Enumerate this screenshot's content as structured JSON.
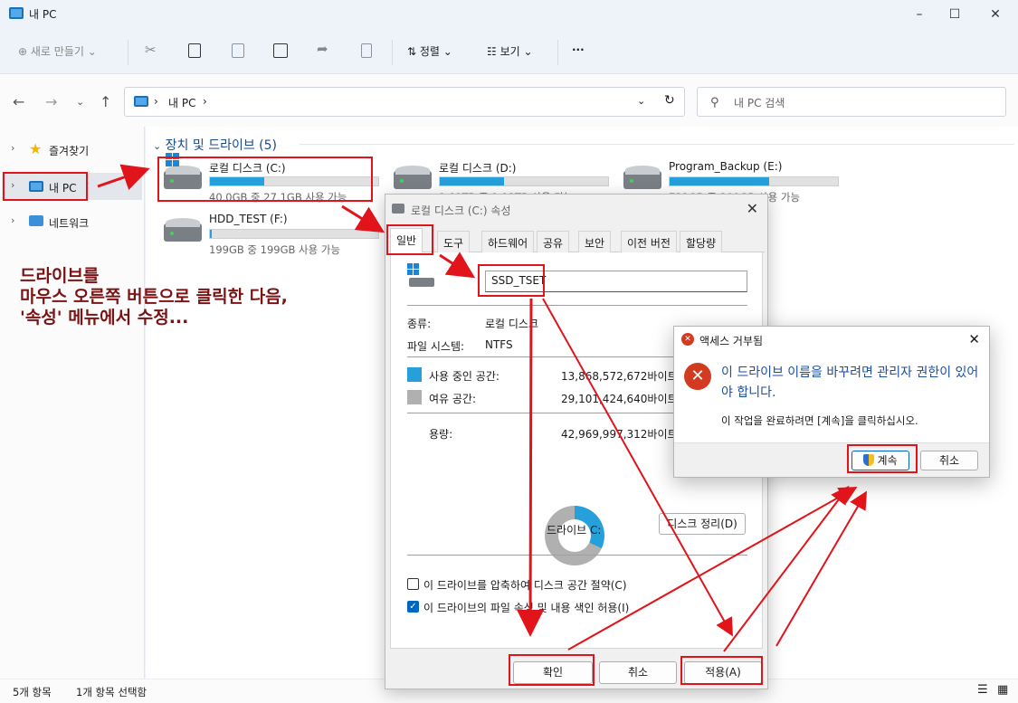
{
  "window": {
    "title": "내 PC"
  },
  "toolbar": {
    "new_label": "새로 만들기",
    "sort_label": "정렬",
    "view_label": "보기",
    "more_label": "···"
  },
  "nav": {
    "breadcrumb_root": "내 PC",
    "search_placeholder": "내 PC 검색"
  },
  "sidebar": {
    "items": [
      {
        "label": "즐겨찾기"
      },
      {
        "label": "내 PC"
      },
      {
        "label": "네트워크"
      }
    ]
  },
  "main": {
    "group_title": "장치 및 드라이브 (5)",
    "drives": [
      {
        "name": "로컬 디스크 (C:)",
        "free_text": "40.0GB 중 27.1GB 사용 가능",
        "used_fraction": 0.32
      },
      {
        "name": "로컬 디스크 (D:)",
        "free_text": "1.81TB 중 1.12TB 사용 가능",
        "used_fraction": 0.38
      },
      {
        "name": "Program_Backup (E:)",
        "free_text": "732GB 중 299GB 사용 가능",
        "used_fraction": 0.59
      },
      {
        "name": "HDD_TEST (F:)",
        "free_text": "199GB 중 199GB 사용 가능",
        "used_fraction": 0.01
      }
    ]
  },
  "status": {
    "item_count": "5개 항목",
    "selected": "1개 항목 선택함"
  },
  "annotation": {
    "text": "드라이브를\n마우스 오른쪽 버튼으로 클릭한 다음,\n'속성' 메뉴에서 수정..."
  },
  "properties": {
    "title": "로컬 디스크 (C:) 속성",
    "tabs": [
      "일반",
      "도구",
      "하드웨어",
      "공유",
      "보안",
      "이전 버전",
      "할당량"
    ],
    "drive_name": "SSD_TSET",
    "type_label": "종류:",
    "type_value": "로컬 디스크",
    "fs_label": "파일 시스템:",
    "fs_value": "NTFS",
    "used_label": "사용 중인 공간:",
    "used_value": "13,868,572,672바이트",
    "free_label": "여유 공간:",
    "free_value": "29,101,424,640바이트",
    "capacity_label": "용량:",
    "capacity_value": "42,969,997,312바이트",
    "used_fraction": 0.32,
    "drive_caption": "드라이브 C:",
    "cleanup_button": "디스크 정리(D)",
    "compress_label": "이 드라이브를 압축하여 디스크 공간 절약(C)",
    "compress_checked": false,
    "index_label": "이 드라이브의 파일 속성 및 내용 색인 허용(I)",
    "index_checked": true,
    "ok_button": "확인",
    "cancel_button": "취소",
    "apply_button": "적용(A)"
  },
  "access_denied": {
    "title": "액세스 거부됨",
    "message": "이 드라이브 이름을 바꾸려면 관리자 권한이 있어야 합니다.",
    "sub_message": "이 작업을 완료하려면 [계속]을 클릭하십시오.",
    "continue_button": "계속",
    "cancel_button": "취소"
  },
  "colors": {
    "used": "#26a0da",
    "free": "#b0b0b0",
    "annotation": "#e0141a",
    "accent": "#0067c0"
  }
}
